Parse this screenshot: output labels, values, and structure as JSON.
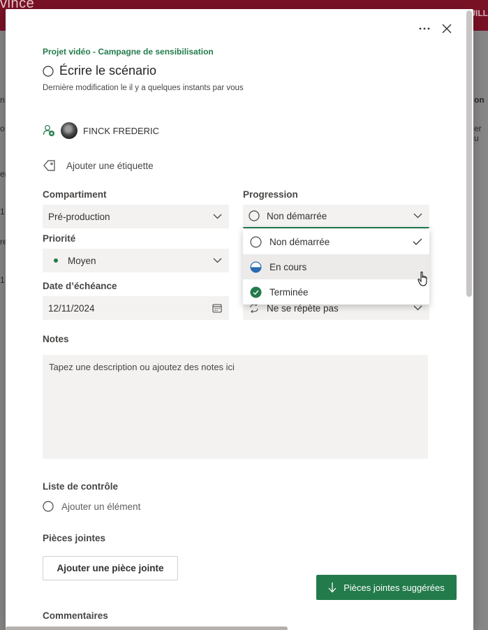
{
  "background": {
    "brand_fragment": "vince",
    "right_fragment": "UILL",
    "left_fragments": [
      "n",
      "o",
      "er",
      "1",
      "re",
      "1"
    ],
    "right_fragments": [
      "on",
      "er u"
    ]
  },
  "task": {
    "project": "Projet vidéo - Campagne de sensibilisation",
    "title": "Écrire le scénario",
    "modified": "Dernière modification le il y a quelques instants par vous",
    "assignee": "FINCK FREDERIC",
    "add_label": "Ajouter une étiquette"
  },
  "fields": {
    "bucket_label": "Compartiment",
    "bucket_value": "Pré-production",
    "progress_label": "Progression",
    "progress_value": "Non démarrée",
    "priority_label": "Priorité",
    "priority_value": "Moyen",
    "due_label": "Date d’échéance",
    "due_value": "12/11/2024",
    "repeat_value": "Ne se répète pas"
  },
  "progress_options": [
    {
      "label": "Non démarrée",
      "selected": true
    },
    {
      "label": "En cours",
      "selected": false
    },
    {
      "label": "Terminée",
      "selected": false
    }
  ],
  "notes": {
    "label": "Notes",
    "placeholder": "Tapez une description ou ajoutez des notes ici"
  },
  "checklist": {
    "label": "Liste de contrôle",
    "add_item": "Ajouter un élément"
  },
  "attachments": {
    "label": "Pièces jointes",
    "add_button": "Ajouter une pièce jointe",
    "suggested_button": "Pièces jointes suggérées"
  },
  "comments": {
    "label": "Commentaires"
  },
  "colors": {
    "accent": "#237b4b",
    "header": "#7a1226",
    "field_bg": "#f3f2f1",
    "in_progress": "#2b6cb0"
  }
}
